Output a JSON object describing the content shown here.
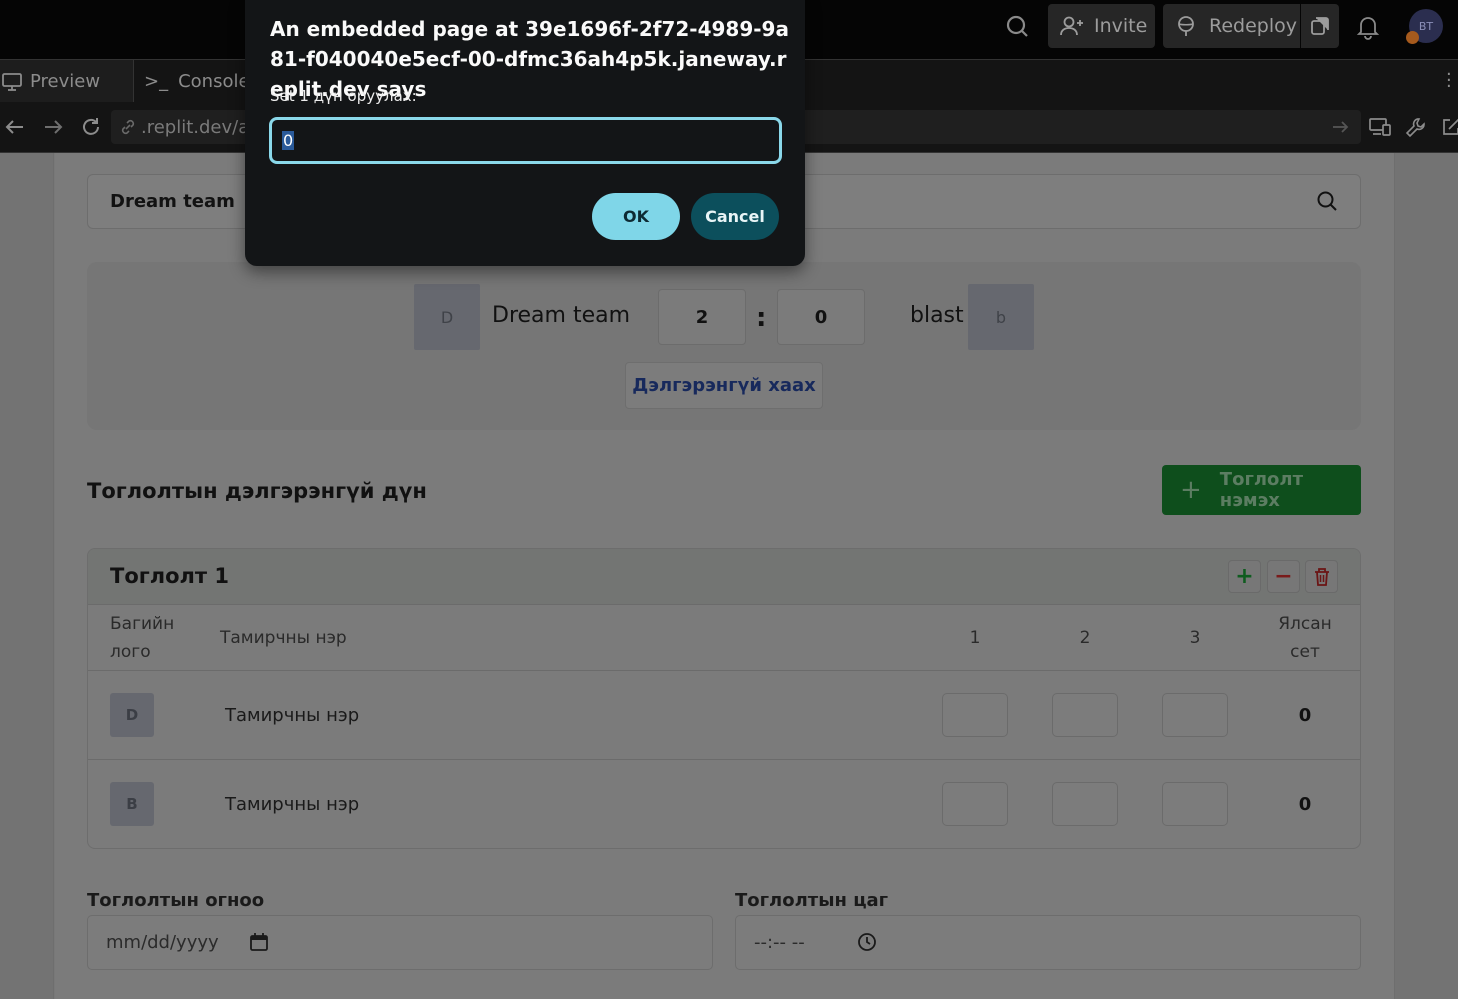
{
  "topbar": {
    "invite_label": "Invite",
    "redeploy_label": "Redeploy",
    "avatar_initials": "BT"
  },
  "tabs": [
    {
      "label": "Preview",
      "active": true
    },
    {
      "label": "Console",
      "active": false
    }
  ],
  "url": {
    "text": ".replit.dev/ad"
  },
  "search": {
    "value": "Dream team"
  },
  "scoreboard": {
    "home_logo": "D",
    "home_name": "Dream team",
    "home_score": "2",
    "separator": ":",
    "away_score": "0",
    "away_name": "blast",
    "away_logo": "b",
    "details_button": "Дэлгэрэнгүй хаах"
  },
  "details": {
    "section_title": "Тоглолтын дэлгэрэнгүй дүн",
    "add_game_button": "Тоглолт нэмэх",
    "game": {
      "title": "Тоглолт 1",
      "columns": {
        "logo_line1": "Багийн",
        "logo_line2": "лого",
        "player": "Тамирчны нэр",
        "set1": "1",
        "set2": "2",
        "set3": "3",
        "won_line1": "Ялсан",
        "won_line2": "сет"
      },
      "rows": [
        {
          "logo": "D",
          "player": "Тамирчны нэр",
          "won_sets": "0"
        },
        {
          "logo": "B",
          "player": "Тамирчны нэр",
          "won_sets": "0"
        }
      ]
    },
    "date": {
      "label": "Тоглолтын огноо",
      "placeholder": "mm/dd/yyyy"
    },
    "time": {
      "label": "Тоглолтын цаг",
      "placeholder": "--:-- --"
    }
  },
  "dialog": {
    "title": "An embedded page at 39e1696f-2f72-4989-9a81-f040040e5ecf-00-dfmc36ah4p5k.janeway.replit.dev says",
    "message": "Set 1 дүн оруулах:",
    "input_value": "0",
    "ok_label": "OK",
    "cancel_label": "Cancel"
  },
  "colors": {
    "dialog_accent": "#7fd6e8",
    "dialog_cancel": "#0c4f5c",
    "add_button": "#0e4e1c",
    "dim_overlay": "#787878"
  }
}
